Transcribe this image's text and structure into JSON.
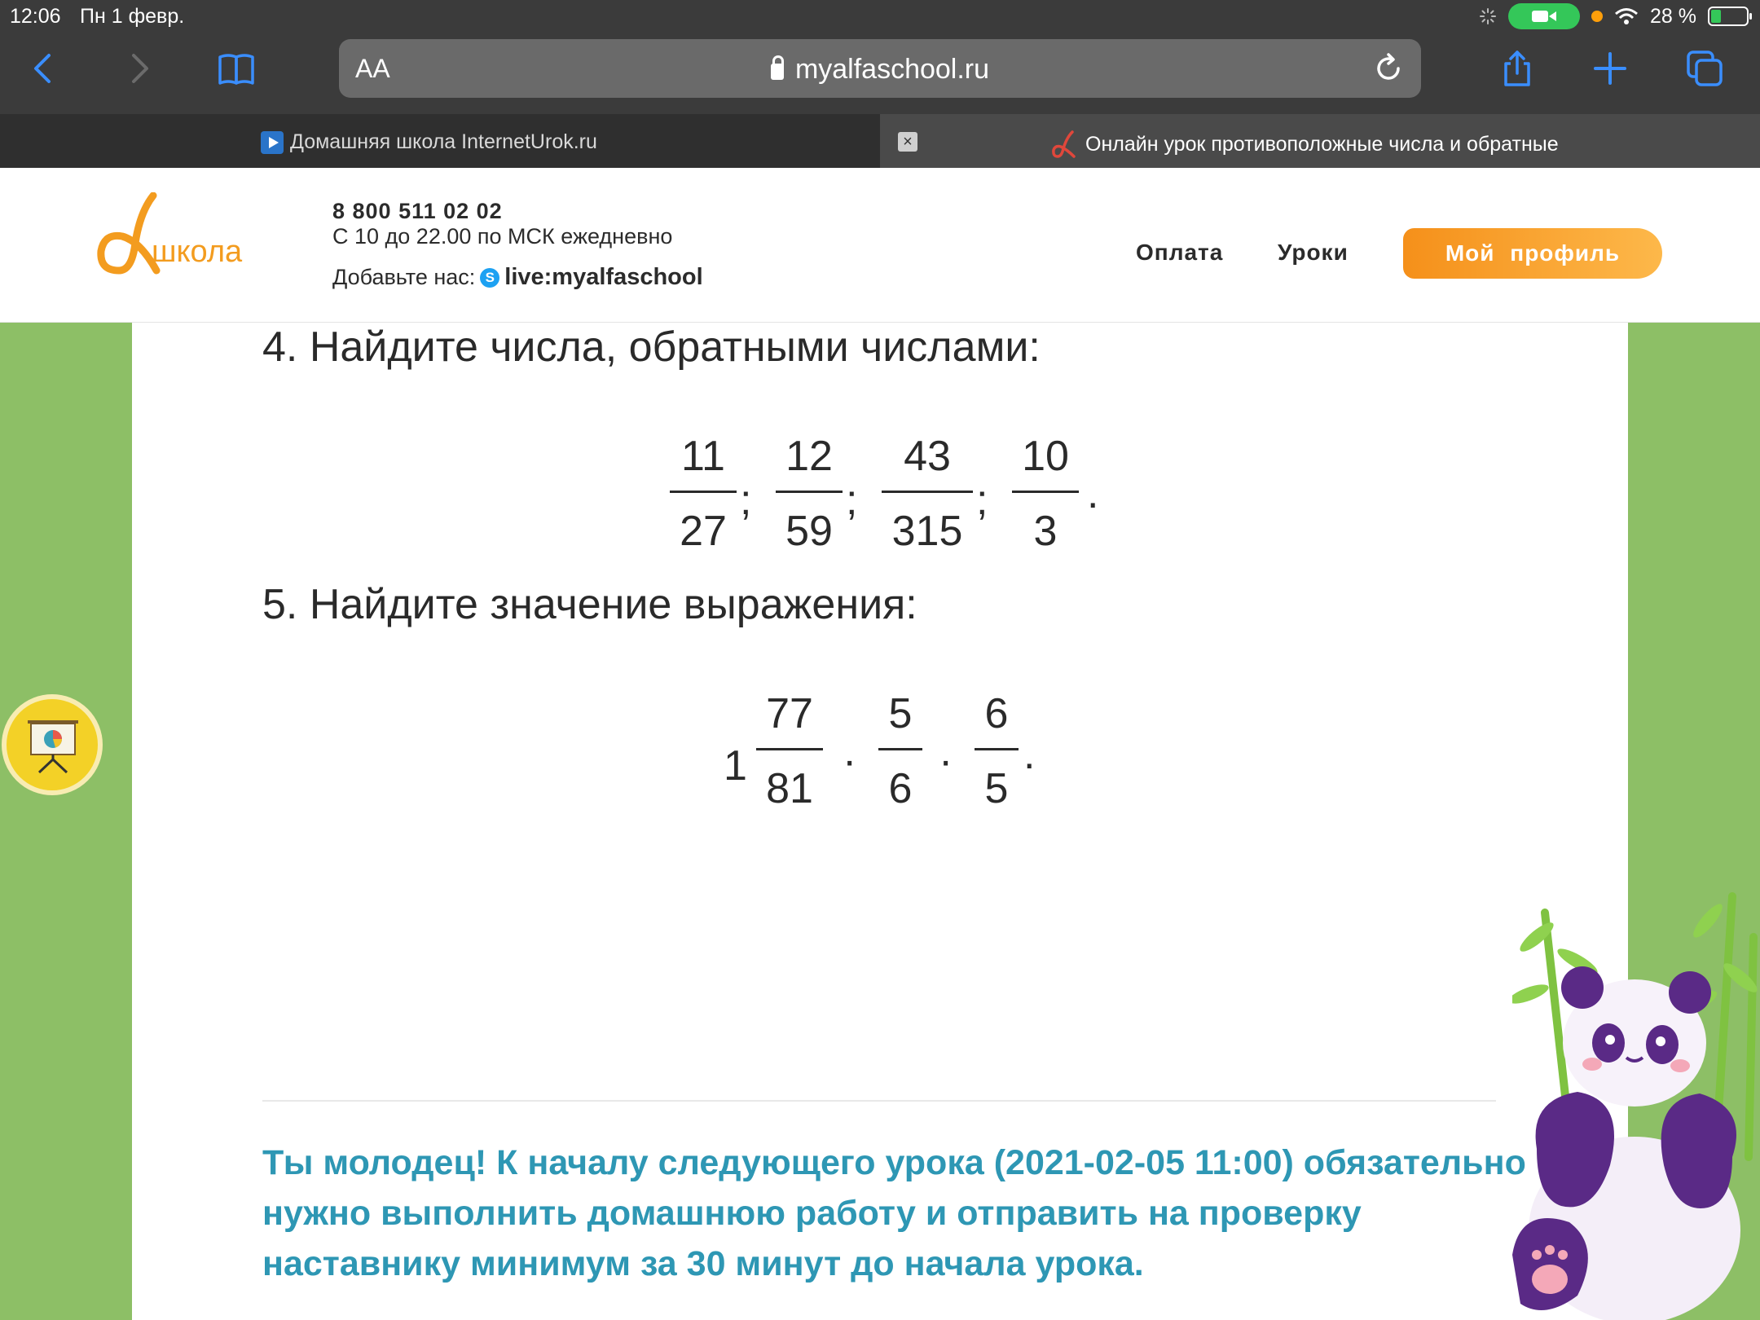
{
  "status_bar": {
    "time": "12:06",
    "date": "Пн 1 февр.",
    "battery": "28 %"
  },
  "browser": {
    "text_size_label": "AA",
    "url_host": "myalfaschool.ru",
    "tabs": [
      {
        "title": "Домашняя школа InternetUrok.ru",
        "active": false
      },
      {
        "title": "Онлайн урок противоположные числа и обратные",
        "active": true
      }
    ]
  },
  "site": {
    "logo_text": "школа",
    "phone": "8 800 511 02 02",
    "hours": "С 10 до 22.00 по МСК ежедневно",
    "add_label": "Добавьте нас:",
    "skype_id": "live:myalfaschool",
    "menu": [
      "Оплата",
      "Уроки"
    ],
    "profile_button": "Мой профиль",
    "brand_color": "#f39c1f"
  },
  "content": {
    "task4": {
      "title": "4.  Найдите числа, обратными числами:",
      "fractions": [
        {
          "num": "11",
          "den": "27"
        },
        {
          "num": "12",
          "den": "59"
        },
        {
          "num": "43",
          "den": "315"
        },
        {
          "num": "10",
          "den": "3"
        }
      ],
      "separator": ";",
      "end": "."
    },
    "task5": {
      "title": "5. Найдите значение выражения:",
      "whole": "1",
      "fractions": [
        {
          "num": "77",
          "den": "81"
        },
        {
          "num": "5",
          "den": "6"
        },
        {
          "num": "6",
          "den": "5"
        }
      ],
      "operator": "·",
      "end": "."
    },
    "note": "Ты молодец! К началу следующего урока (2021-02-05 11:00) обязательно нужно выполнить домашнюю работу и отправить на проверку наставнику минимум за 30 минут до начала урока.",
    "note_color": "#2e97b4"
  }
}
